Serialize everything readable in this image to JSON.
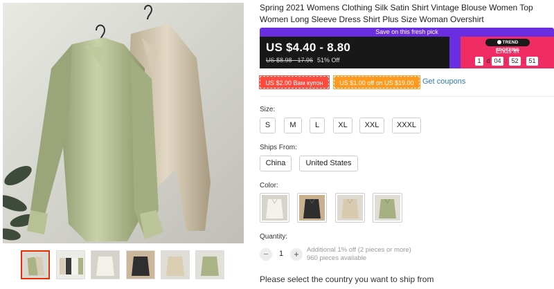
{
  "product": {
    "title": "Spring 2021 Womens Clothing Silk Satin Shirt Vintage Blouse Women Top Women Long Sleeve Dress Shirt Plus Size Woman Overshirt"
  },
  "deal": {
    "banner": "Save on this fresh pick",
    "price": "US $4.40 - 8.80",
    "old_price": "US $8.98 - 17.96",
    "discount": "51% Off",
    "trend_label": "TREND SPOTTING",
    "ends_in_label": "Ends in",
    "countdown": {
      "days": "1",
      "days_unit": "d",
      "hours": "04",
      "minutes": "52",
      "seconds": "51"
    }
  },
  "coupons": {
    "store_coupon": "US $2.00 Вам купон",
    "promo_coupon": "US $1.00 off on US $19.00",
    "get_coupons_link": "Get coupons"
  },
  "options": {
    "size_label": "Size:",
    "sizes": [
      "S",
      "M",
      "L",
      "XL",
      "XXL",
      "XXXL"
    ],
    "ships_from_label": "Ships From:",
    "ships_from": [
      "China",
      "United States"
    ],
    "color_label": "Color:",
    "colors": [
      "white",
      "black",
      "champagne",
      "olive-green"
    ]
  },
  "quantity": {
    "label": "Quantity:",
    "value": "1",
    "decrease": "−",
    "increase": "+",
    "additional_note": "Additional 1% off (2 pieces or more)",
    "available": "960 pieces available"
  },
  "shipping": {
    "message": "Please select the country you want to ship from"
  },
  "colors_theme": {
    "accent_red": "#e62e04",
    "deal_purple": "#6b2de0",
    "trend_pink": "#ef2c63",
    "link_blue": "#2f7bbf"
  },
  "gallery": {
    "thumbnails": [
      "green-and-champagne-shirts",
      "four-color-shirts",
      "white-shirt",
      "black-shirt",
      "champagne-shirt",
      "green-shirt"
    ]
  }
}
